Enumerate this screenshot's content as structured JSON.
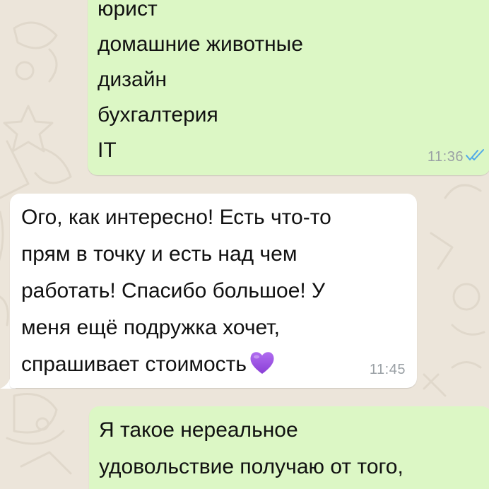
{
  "messages": [
    {
      "direction": "outgoing",
      "lines": [
        "юрист",
        "домашние животные",
        "дизайн",
        "бухгалтерия",
        "IT"
      ],
      "time": "11:36",
      "status_icon": "double-check-icon",
      "status_color": "#4fa8e8"
    },
    {
      "direction": "incoming",
      "lines": [
        "Ого, как интересно! Есть что-то",
        "прям в точку и есть над чем",
        "работать! Спасибо большое! У",
        "меня ещё подружка хочет,",
        "спрашивает стоимость"
      ],
      "emoji": "purple-heart-icon",
      "time": "11:45"
    },
    {
      "direction": "outgoing",
      "lines": [
        "Я такое нереальное",
        "удовольствие получаю от того,"
      ]
    }
  ],
  "colors": {
    "wallpaper": "#ece5da",
    "outgoing_bubble": "#dcf7c5",
    "incoming_bubble": "#ffffff",
    "heart": "#9b4ee0"
  }
}
